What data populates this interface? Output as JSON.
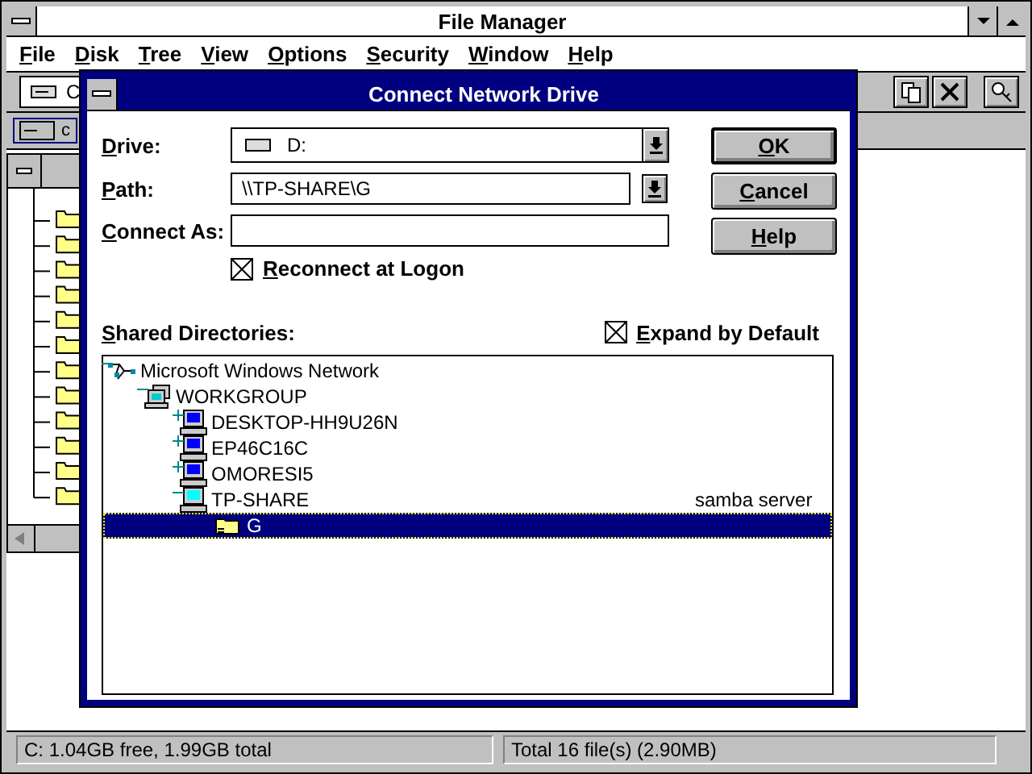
{
  "window": {
    "title": "File Manager"
  },
  "menu": [
    "File",
    "Disk",
    "Tree",
    "View",
    "Options",
    "Security",
    "Window",
    "Help"
  ],
  "toolbar": {
    "drive_combo": "C"
  },
  "drive_bar": [
    {
      "label": "c",
      "selected": true
    }
  ],
  "dialog": {
    "title": "Connect Network Drive",
    "drive": {
      "label": "Drive:",
      "value": "D:"
    },
    "path": {
      "label": "Path:",
      "value": "\\\\TP-SHARE\\G"
    },
    "connect_as": {
      "label": "Connect As:"
    },
    "reconnect": {
      "label": "Reconnect at Logon",
      "checked": true
    },
    "shared_label": "Shared Directories:",
    "expand": {
      "label": "Expand by Default",
      "checked": true
    },
    "tree": [
      {
        "name": "Microsoft Windows Network",
        "kind": "network",
        "expanded": true,
        "selected": false,
        "children": [
          {
            "name": "WORKGROUP",
            "kind": "workgroup",
            "expanded": true,
            "selected": false,
            "children": [
              {
                "name": "DESKTOP-HH9U26N",
                "kind": "computer",
                "expanded": false,
                "selected": false
              },
              {
                "name": "EP46C16C",
                "kind": "computer",
                "expanded": false,
                "selected": false
              },
              {
                "name": "OMORESI5",
                "kind": "computer",
                "expanded": false,
                "selected": false
              },
              {
                "name": "TP-SHARE",
                "kind": "server",
                "expanded": true,
                "selected": false,
                "comment": "samba server",
                "children": [
                  {
                    "name": "G",
                    "kind": "share",
                    "selected": true
                  }
                ]
              }
            ]
          }
        ]
      }
    ],
    "buttons": [
      {
        "label": "OK",
        "default": true
      },
      {
        "label": "Cancel",
        "default": false
      },
      {
        "label": "Help",
        "default": false
      }
    ]
  },
  "status_bar": [
    "C: 1.04GB free,  1.99GB total",
    "Total 16 file(s) (2.90MB)"
  ]
}
